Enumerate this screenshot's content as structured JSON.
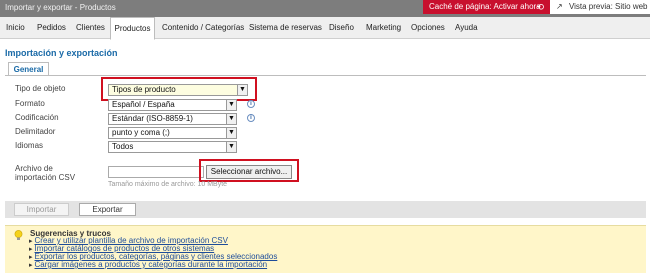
{
  "window": {
    "title": "Importar y exportar - Productos"
  },
  "topbar": {
    "cache_label": "Caché de página: Activar ahora",
    "cache_icon": "refresh-arrows-icon",
    "preview_label": "Vista previa: Sitio web",
    "preview_icon": "external-link-icon"
  },
  "nav": {
    "items": [
      "Inicio",
      "Pedidos",
      "Clientes",
      "Productos",
      "Contenido / Categorías",
      "Sistema de reservas",
      "Diseño",
      "Marketing",
      "Opciones",
      "Ayuda"
    ],
    "active": "Productos"
  },
  "page": {
    "title": "Importación y exportación",
    "tab": "General"
  },
  "form": {
    "object_type": {
      "label": "Tipo de objeto",
      "value": "Tipos de producto"
    },
    "format": {
      "label": "Formato",
      "value": "Español / España"
    },
    "encoding": {
      "label": "Codificación",
      "value": "Estándar (ISO-8859-1)"
    },
    "delimiter": {
      "label": "Delimitador",
      "value": "punto y coma (;)"
    },
    "languages": {
      "label": "Idiomas",
      "value": "Todos"
    },
    "file": {
      "label": "Archivo de importación CSV",
      "button": "Seleccionar archivo...",
      "hint": "Tamaño máximo de archivo: 10 MByte"
    }
  },
  "actions": {
    "import": "Importar",
    "export": "Exportar"
  },
  "tips": {
    "heading": "Sugerencias y trucos",
    "links": [
      "Crear y utilizar plantilla de archivo de importación CSV",
      "Importar catálogos de productos de otros sistemas",
      "Exportar los productos, categorías, páginas y clientes seleccionados",
      "Cargar imágenes a productos y categorías durante la importación"
    ]
  },
  "colors": {
    "highlight": "#d01020",
    "link": "#1d4c9a",
    "accent": "#c8102e",
    "tips_bg": "#fff6c9"
  }
}
